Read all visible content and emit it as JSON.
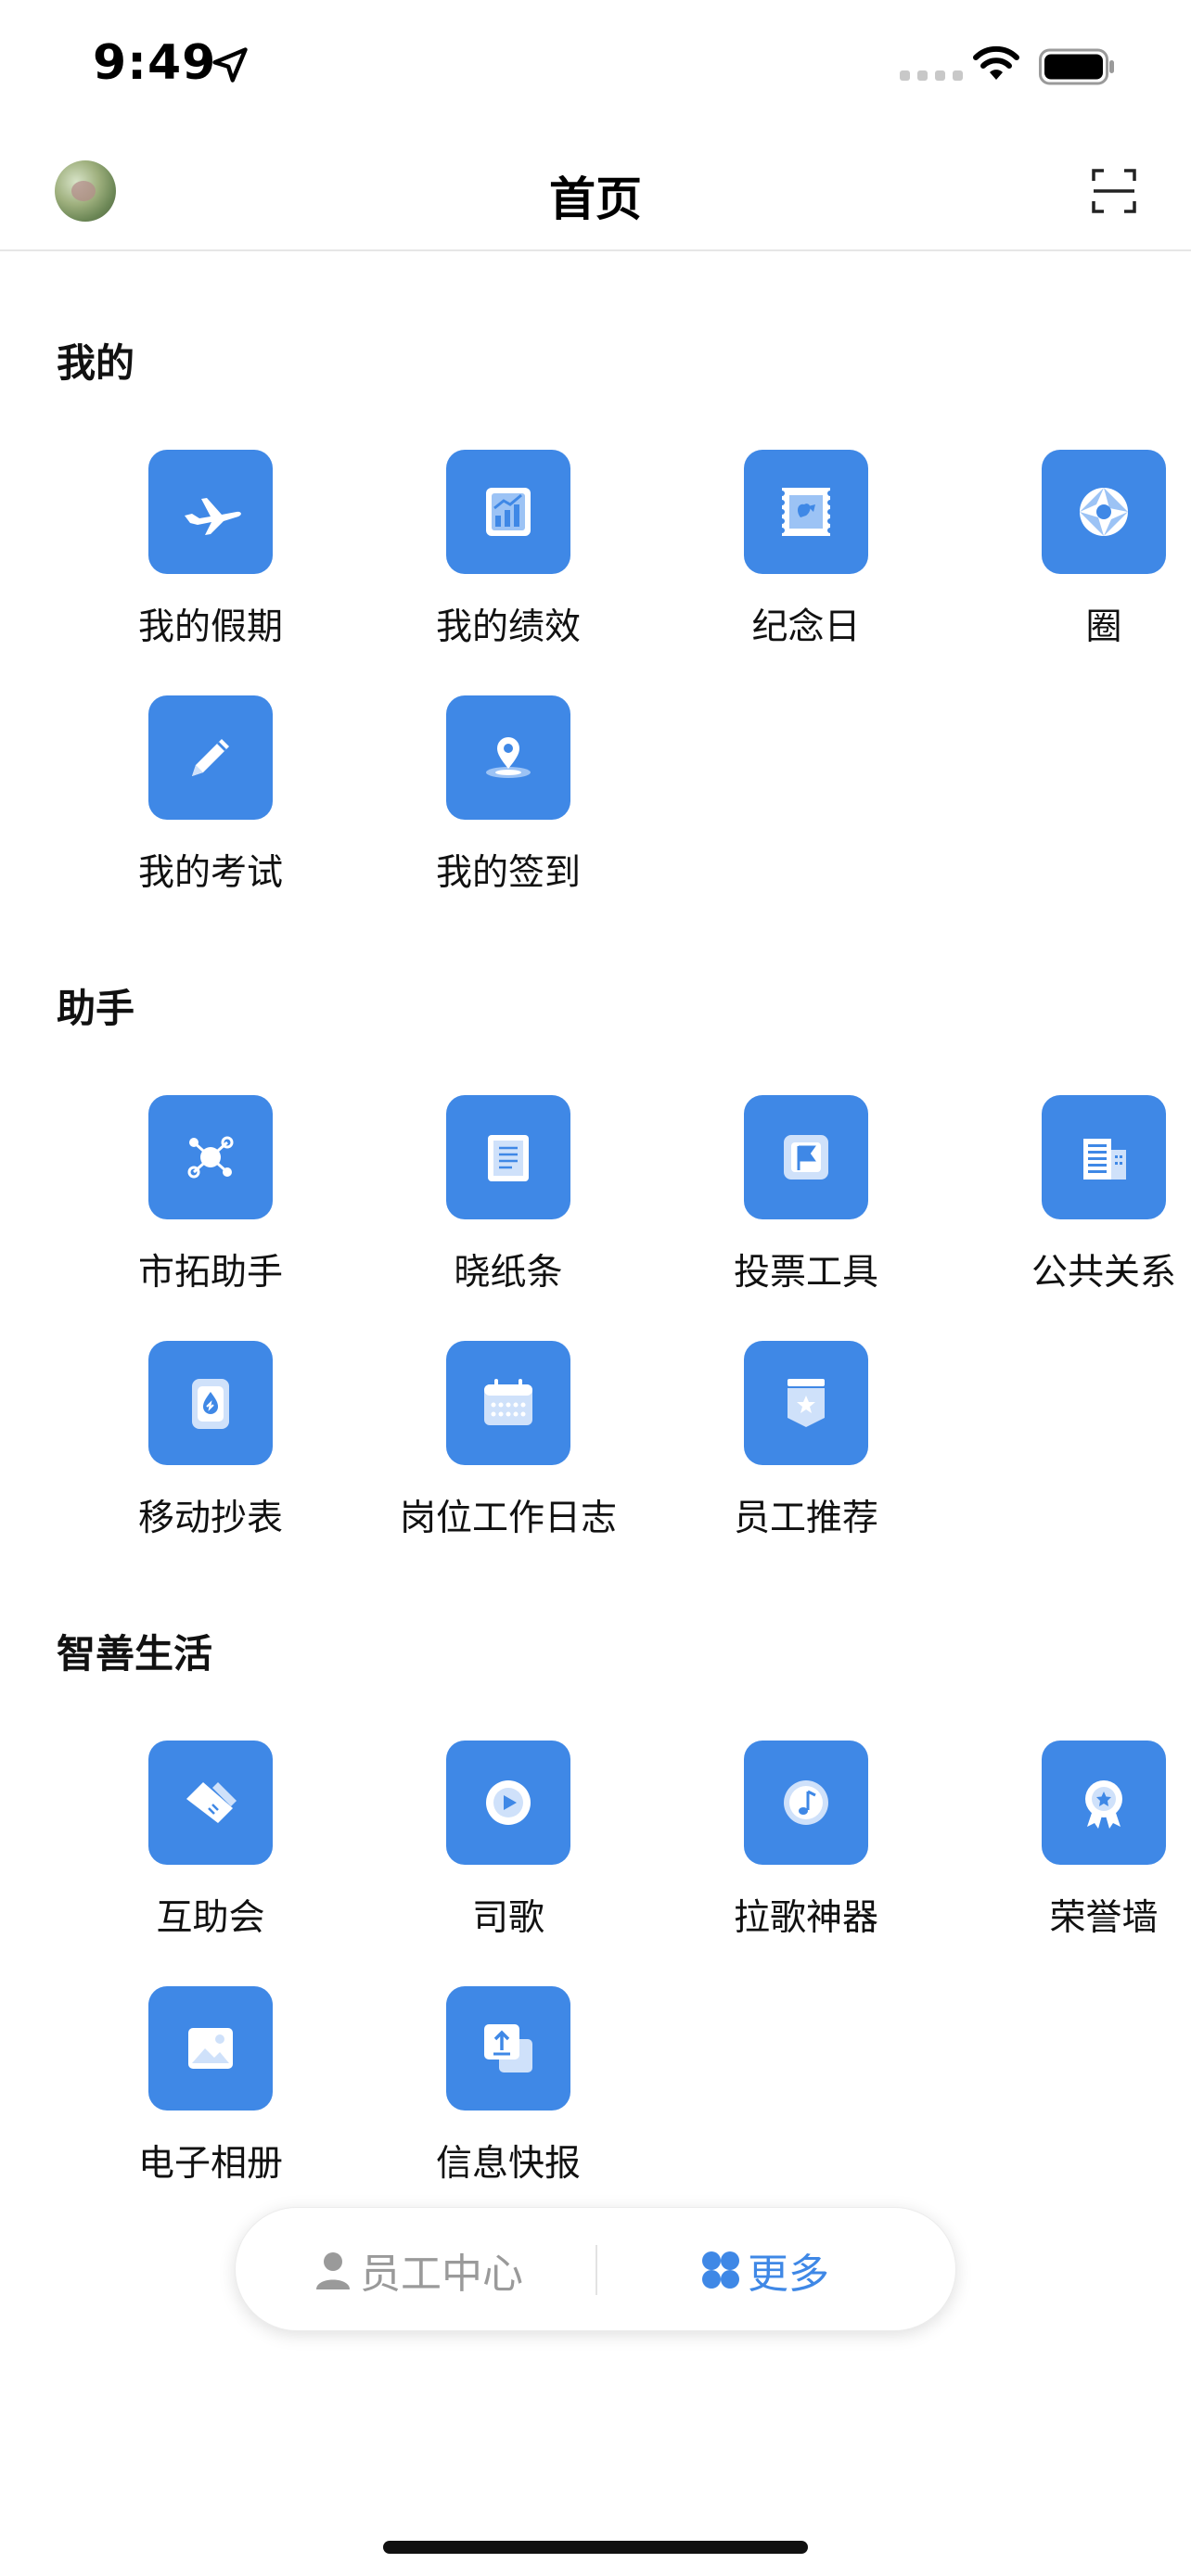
{
  "status_bar": {
    "time": "9:49"
  },
  "nav": {
    "title": "首页"
  },
  "sections": [
    {
      "title": "我的",
      "items": [
        {
          "label": "我的假期",
          "icon": "airplane-icon"
        },
        {
          "label": "我的绩效",
          "icon": "performance-chart-icon"
        },
        {
          "label": "纪念日",
          "icon": "stamp-icon"
        },
        {
          "label": "圈",
          "icon": "aperture-icon"
        },
        {
          "label": "我的考试",
          "icon": "pencil-icon"
        },
        {
          "label": "我的签到",
          "icon": "location-pin-icon"
        }
      ]
    },
    {
      "title": "助手",
      "items": [
        {
          "label": "市拓助手",
          "icon": "network-hub-icon"
        },
        {
          "label": "晓纸条",
          "icon": "note-paper-icon"
        },
        {
          "label": "投票工具",
          "icon": "vote-flag-icon"
        },
        {
          "label": "公共关系",
          "icon": "building-icon"
        },
        {
          "label": "移动抄表",
          "icon": "water-meter-icon"
        },
        {
          "label": "岗位工作日志",
          "icon": "calendar-icon"
        },
        {
          "label": "员工推荐",
          "icon": "star-badge-icon"
        }
      ]
    },
    {
      "title": "智善生活",
      "items": [
        {
          "label": "互助会",
          "icon": "handshake-icon"
        },
        {
          "label": "司歌",
          "icon": "play-icon"
        },
        {
          "label": "拉歌神器",
          "icon": "music-note-icon"
        },
        {
          "label": "荣誉墙",
          "icon": "award-ribbon-icon"
        },
        {
          "label": "电子相册",
          "icon": "photo-album-icon"
        },
        {
          "label": "信息快报",
          "icon": "upload-report-icon"
        }
      ]
    }
  ],
  "bottom_bar": {
    "left_label": "员工中心",
    "right_label": "更多"
  },
  "colors": {
    "accent": "#3f88e6",
    "inactive": "#9a9a9a"
  }
}
